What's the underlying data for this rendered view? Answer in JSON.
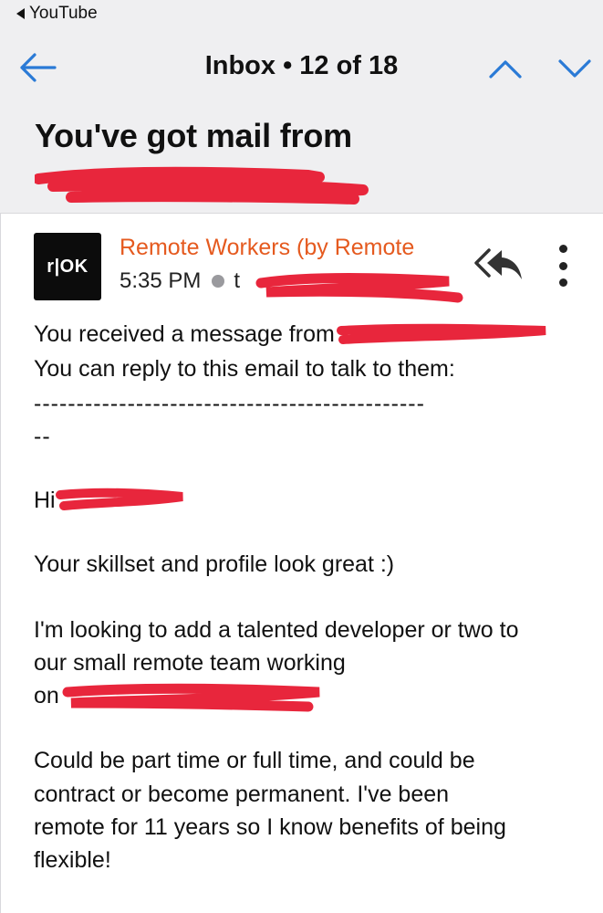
{
  "status_bar": {
    "back_app_label": "YouTube"
  },
  "nav": {
    "title": "Inbox • 12 of 18"
  },
  "email": {
    "subject": "You've got mail from",
    "sender": "Remote Workers (by Remote",
    "avatar_text": "r|OK",
    "time": "5:35 PM",
    "to_prefix": "t",
    "body": {
      "line1": "You received a message from",
      "line2": "You can reply to this email to talk to them:",
      "divider": "----------------------------------------------",
      "divider2": "--",
      "greeting": "Hi",
      "para1": "Your skillset and profile look great :)",
      "para2_l1": "I'm looking to add a talented developer or two to",
      "para2_l2": "our small remote team working",
      "para2_l3": "on",
      "para3_l1": "Could be part time or full time, and could be",
      "para3_l2": "contract or become permanent. I've been",
      "para3_l3": "remote for 11 years so I know benefits of being",
      "para3_l4": "flexible!"
    }
  },
  "colors": {
    "accent": "#2a7ad6",
    "sender": "#e55a1f",
    "redaction": "#e8263c"
  },
  "icons": {
    "back": "arrow-left-icon",
    "up": "chevron-up-icon",
    "down": "chevron-down-icon",
    "reply_all": "reply-all-icon",
    "more": "more-vertical-icon"
  }
}
